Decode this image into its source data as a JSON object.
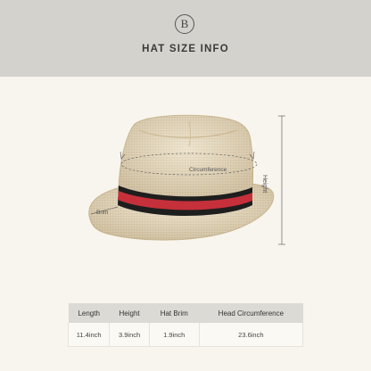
{
  "header": {
    "logo_letter": "B",
    "title": "HAT SIZE INFO"
  },
  "diagram": {
    "circumference_label": "Circumference",
    "height_label": "Height",
    "brim_label": "Brim"
  },
  "table": {
    "headers": [
      "Length",
      "Height",
      "Hat Brim",
      "Head Circumference"
    ],
    "values": [
      "11.4inch",
      "3.9inch",
      "1.9inch",
      "23.6inch"
    ]
  },
  "colors": {
    "header_bg": "#d4d2cd",
    "page_bg": "#f8f5ee",
    "band_red": "#c6303a",
    "band_black": "#1e1e1e",
    "straw": "#e6d8bb"
  }
}
